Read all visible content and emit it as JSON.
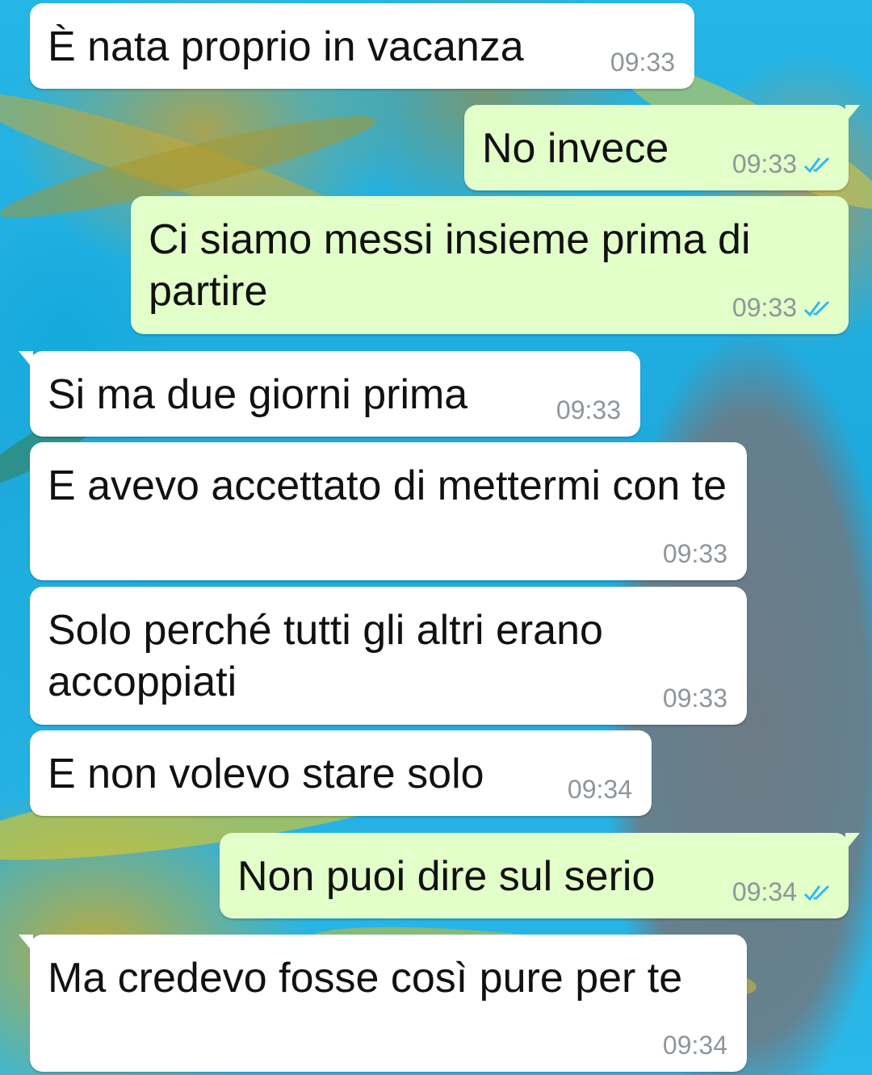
{
  "colors": {
    "incoming_bubble": "#ffffff",
    "outgoing_bubble": "#e2ffc9",
    "timestamp": "#8f969a",
    "read_ticks": "#34b7f1"
  },
  "messages": [
    {
      "direction": "in",
      "text": "È nata proprio in vacanza",
      "time": "09:33"
    },
    {
      "direction": "out",
      "text": "No invece",
      "time": "09:33",
      "status": "read"
    },
    {
      "direction": "out",
      "text": "Ci siamo messi insieme prima di partire",
      "time": "09:33",
      "status": "read"
    },
    {
      "direction": "in",
      "text": "Si ma due giorni prima",
      "time": "09:33"
    },
    {
      "direction": "in",
      "text": "E avevo accettato di mettermi con te",
      "time": "09:33"
    },
    {
      "direction": "in",
      "text": "Solo perché tutti gli altri erano accoppiati",
      "time": "09:33"
    },
    {
      "direction": "in",
      "text": "E non volevo stare solo",
      "time": "09:34"
    },
    {
      "direction": "out",
      "text": "Non puoi dire sul serio",
      "time": "09:34",
      "status": "read"
    },
    {
      "direction": "in",
      "text": "Ma credevo fosse così pure per te",
      "time": "09:34"
    }
  ]
}
